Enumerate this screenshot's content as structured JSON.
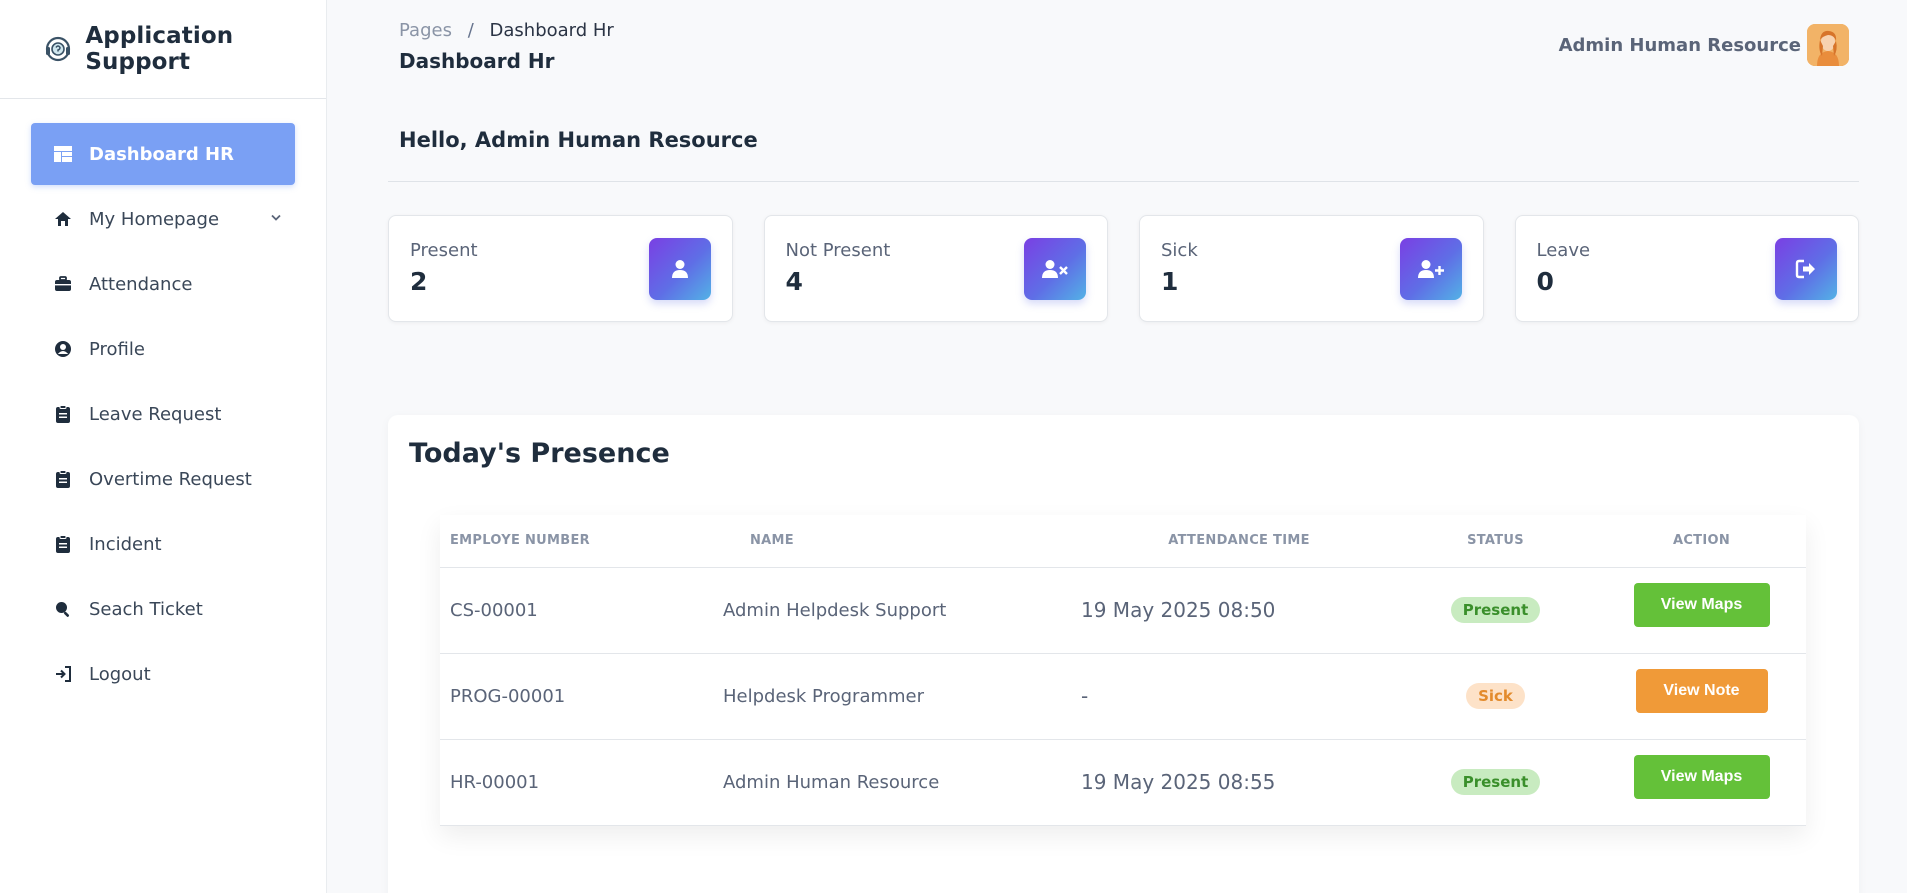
{
  "brand": {
    "title": "Application Support"
  },
  "sidebar": {
    "items": [
      {
        "label": "Dashboard HR",
        "icon": "dashboard-icon",
        "active": true
      },
      {
        "label": "My Homepage",
        "icon": "home-icon"
      },
      {
        "label": "Attendance",
        "icon": "briefcase-icon"
      },
      {
        "label": "Profile",
        "icon": "user-circle-icon"
      },
      {
        "label": "Leave Request",
        "icon": "clipboard-icon"
      },
      {
        "label": "Overtime Request",
        "icon": "clipboard-icon"
      },
      {
        "label": "Incident",
        "icon": "clipboard-icon"
      },
      {
        "label": "Seach Ticket",
        "icon": "search-icon"
      },
      {
        "label": "Logout",
        "icon": "logout-icon"
      }
    ]
  },
  "header": {
    "breadcrumb_root": "Pages",
    "breadcrumb_sep": "/",
    "breadcrumb_current": "Dashboard Hr",
    "title": "Dashboard Hr",
    "user_name": "Admin Human Resource"
  },
  "greeting": "Hello, Admin Human Resource",
  "stats": [
    {
      "label": "Present",
      "value": "2",
      "icon": "user-icon"
    },
    {
      "label": "Not Present",
      "value": "4",
      "icon": "user-times-icon"
    },
    {
      "label": "Sick",
      "value": "1",
      "icon": "user-plus-icon"
    },
    {
      "label": "Leave",
      "value": "0",
      "icon": "sign-out-icon"
    }
  ],
  "presence": {
    "title": "Today's Presence",
    "columns": [
      "Employe Number",
      "Name",
      "Attendance Time",
      "Status",
      "Action"
    ],
    "rows": [
      {
        "number": "CS-00001",
        "name": "Admin Helpdesk Support",
        "time": "19 May 2025 08:50",
        "status": "Present",
        "action": "View Maps"
      },
      {
        "number": "PROG-00001",
        "name": "Helpdesk Programmer",
        "time": "-",
        "status": "Sick",
        "action": "View Note"
      },
      {
        "number": "HR-00001",
        "name": "Admin Human Resource",
        "time": "19 May 2025 08:55",
        "status": "Present",
        "action": "View Maps"
      }
    ]
  },
  "colors": {
    "active_nav": "#7aa0f4",
    "present_badge_bg": "#c8ebc0",
    "present_badge_text": "#3a8f2b",
    "sick_badge_bg": "#fde2c8",
    "sick_badge_text": "#e38b2c",
    "button_green": "#64c139",
    "button_orange": "#f09a38"
  }
}
